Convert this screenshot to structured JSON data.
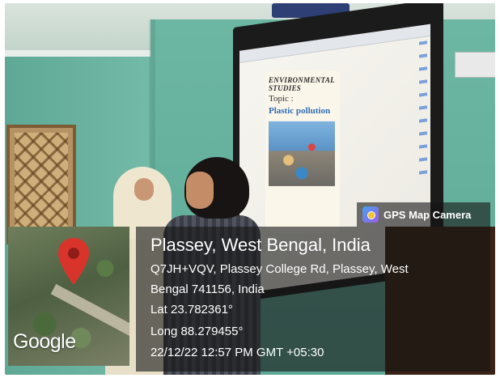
{
  "slide": {
    "heading": "ENVIRONMENTAL STUDIES",
    "topic_label": "Topic :",
    "subject": "Plastic pollution"
  },
  "badge": {
    "label": "GPS Map Camera",
    "icon": "gps-map-camera-icon"
  },
  "map": {
    "brand": "Google",
    "pin_icon": "map-pin-icon",
    "pin_color": "#d9342b"
  },
  "location": {
    "title": "Plassey, West Bengal, India",
    "address_line1": "Q7JH+VQV, Plassey College Rd, Plassey, West",
    "address_line2": "Bengal 741156, India",
    "latitude": "Lat 23.782361°",
    "longitude": "Long 88.279455°",
    "datetime": "22/12/22 12:57 PM GMT +05:30"
  }
}
